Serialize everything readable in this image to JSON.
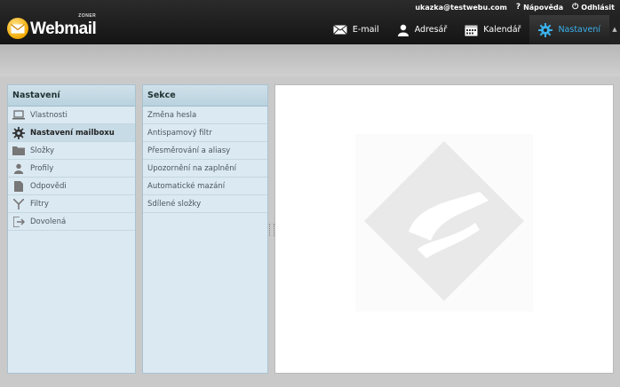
{
  "header": {
    "user_email": "ukazka@testwebu.com",
    "help_label": "Nápověda",
    "logout_label": "Odhlásit",
    "logo_text": "Webmail",
    "logo_brand": "ZONER",
    "nav": {
      "email": "E-mail",
      "contacts": "Adresář",
      "calendar": "Kalendář",
      "settings": "Nastavení"
    }
  },
  "settings_panel": {
    "title": "Nastavení",
    "items": [
      {
        "label": "Vlastnosti",
        "icon": "laptop-icon"
      },
      {
        "label": "Nastavení mailboxu",
        "icon": "gear-icon",
        "selected": true
      },
      {
        "label": "Složky",
        "icon": "folder-icon"
      },
      {
        "label": "Profily",
        "icon": "user-icon"
      },
      {
        "label": "Odpovědi",
        "icon": "document-icon"
      },
      {
        "label": "Filtry",
        "icon": "filter-icon"
      },
      {
        "label": "Dovolená",
        "icon": "exit-icon"
      }
    ]
  },
  "sections_panel": {
    "title": "Sekce",
    "items": [
      "Změna hesla",
      "Antispamový filtr",
      "Přesměrování a aliasy",
      "Upozornění na zaplnění",
      "Automatické mazání",
      "Sdílené složky"
    ]
  },
  "colors": {
    "accent": "#3ab0ea",
    "topbar": "#1a1a1a",
    "panel_bg": "#dbe9f2"
  }
}
